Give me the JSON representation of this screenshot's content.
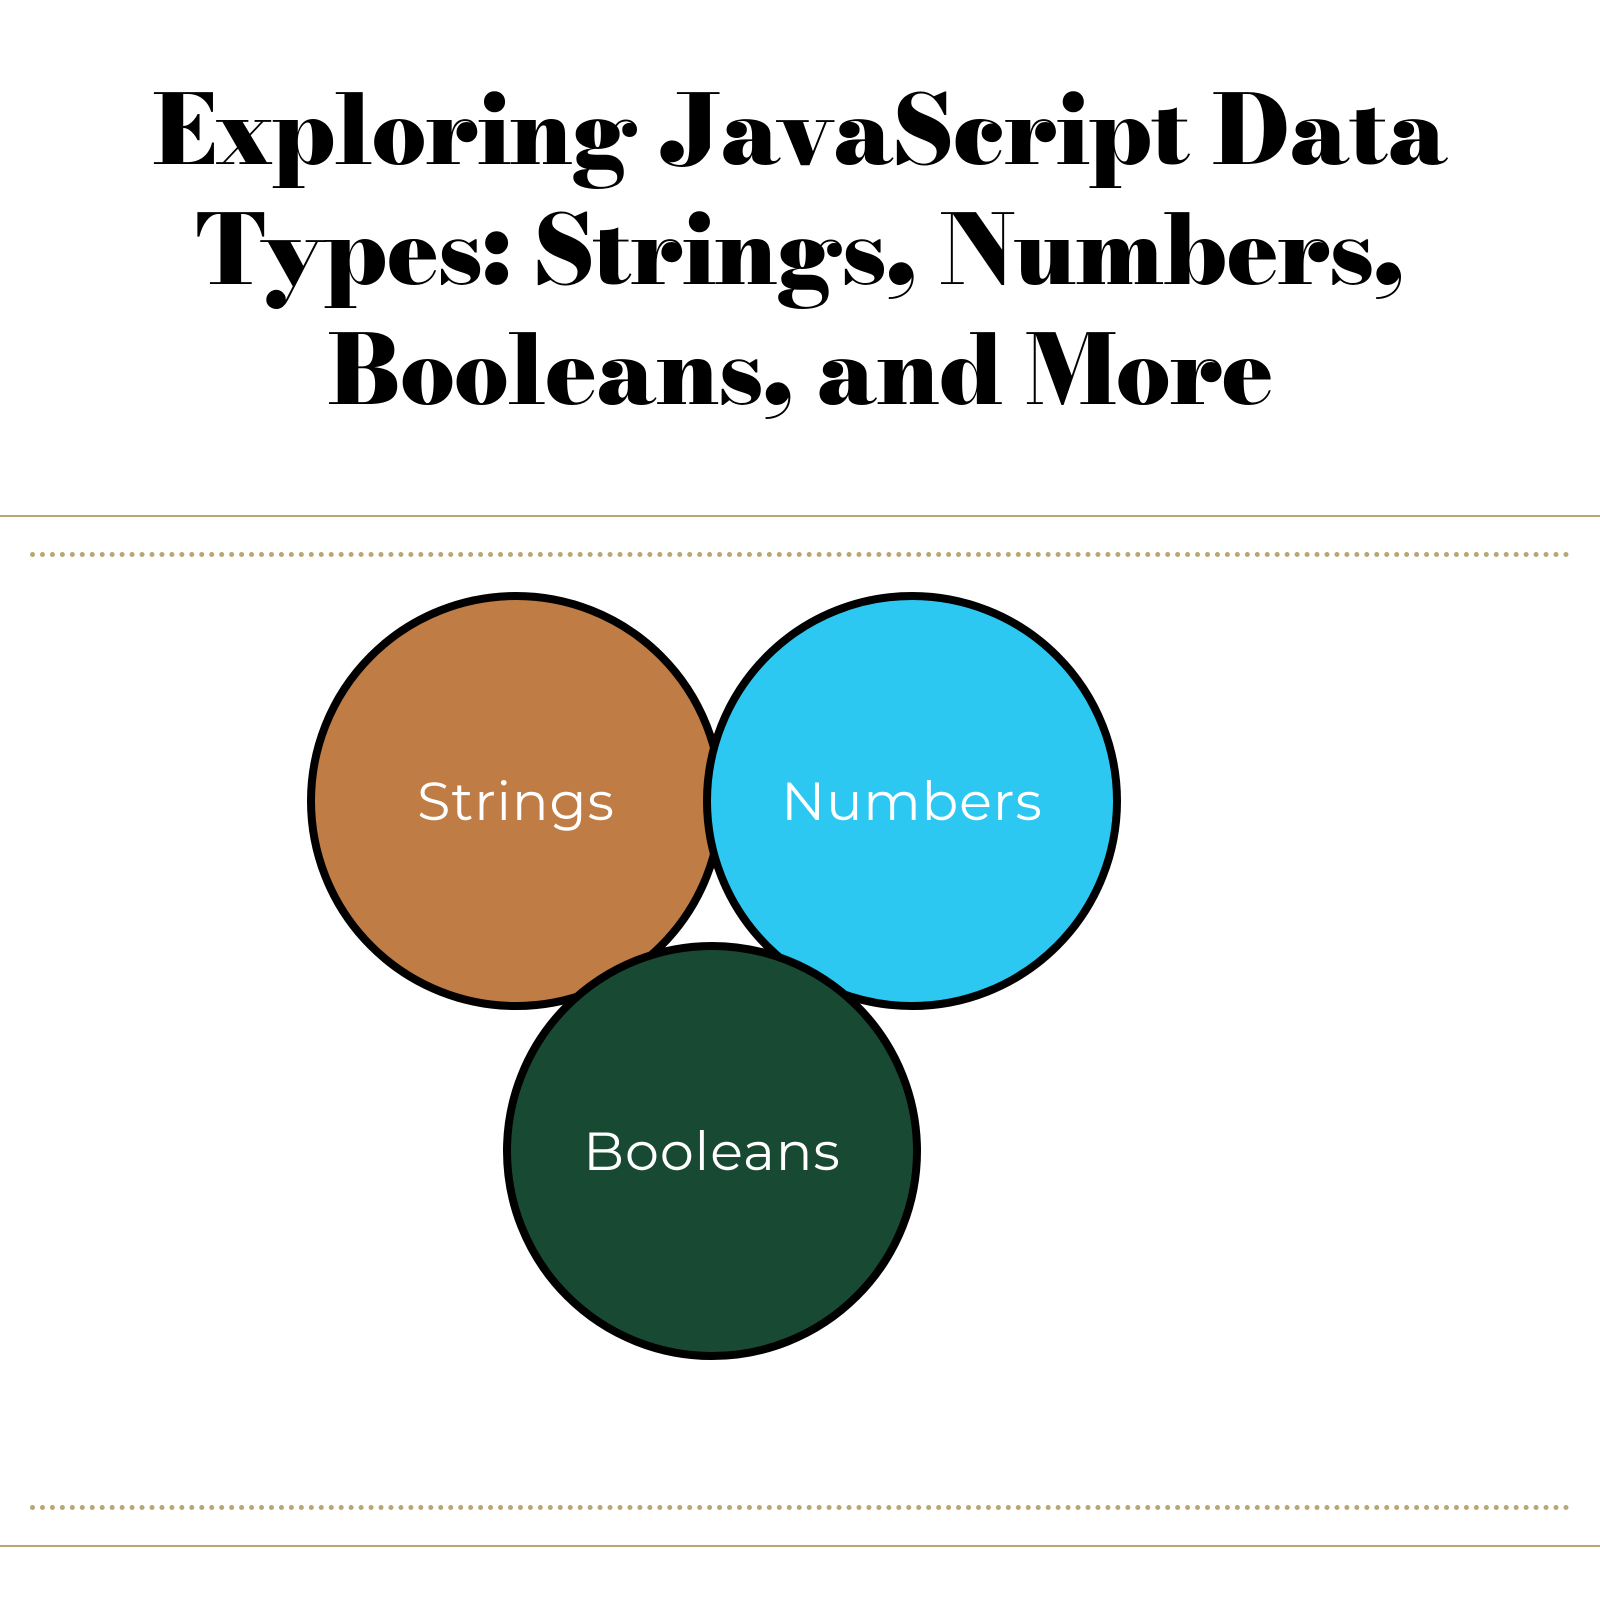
{
  "title": "Exploring JavaScript Data Types: Strings, Numbers, Booleans, and More",
  "circles": {
    "strings": {
      "label": "Strings",
      "color": "#bf7c44"
    },
    "numbers": {
      "label": "Numbers",
      "color": "#2cc8f2"
    },
    "booleans": {
      "label": "Booleans",
      "color": "#184a33"
    }
  },
  "accent_color": "#b8a673"
}
